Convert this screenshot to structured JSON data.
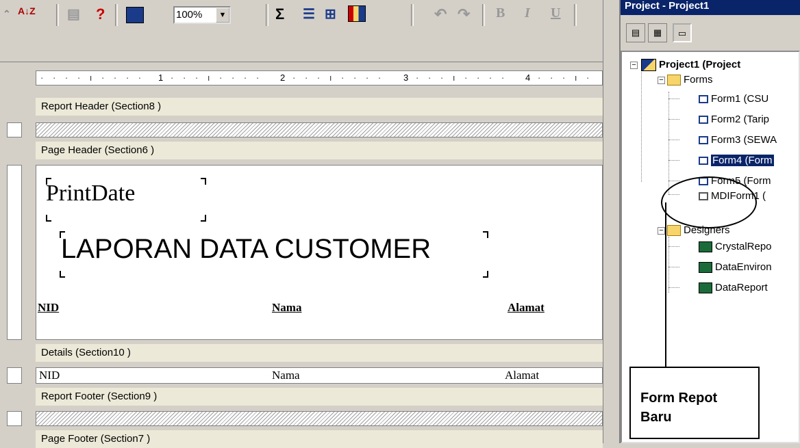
{
  "toolbar": {
    "zoom_value": "100%",
    "icons": [
      "sort-icon",
      "rows-icon",
      "help-icon",
      "save-as-icon",
      "sum-icon",
      "group-icon",
      "cross-tab-icon",
      "chart-icon",
      "undo-icon",
      "redo-icon",
      "bold-icon",
      "italic-icon",
      "underline-icon"
    ],
    "sort_glyph": "A↓Z",
    "help_glyph": "?",
    "sum_glyph": "Σ",
    "bold_glyph": "B",
    "italic_glyph": "I",
    "underline_glyph": "U",
    "undo_glyph": "↶",
    "redo_glyph": "↷"
  },
  "ruler": {
    "marks": [
      "1",
      "2",
      "3",
      "4"
    ]
  },
  "sections": {
    "report_header": "Report Header  (Section8 )",
    "page_header": "Page Header  (Section6 )",
    "details": "Details  (Section10 )",
    "report_footer": "Report Footer  (Section9 )",
    "page_footer": "Page Footer  (Section7 )"
  },
  "page_header_fields": {
    "print_date": "PrintDate",
    "title": "LAPORAN DATA CUSTOMER",
    "col_nid": "NID",
    "col_nama": "Nama",
    "col_alamat": "Alamat"
  },
  "details_fields": {
    "nid": "NID",
    "nama": "Nama",
    "alamat": "Alamat"
  },
  "project": {
    "title": "Project - Project1",
    "root": "Project1 (Project",
    "forms_folder": "Forms",
    "forms": [
      "Form1 (CSU",
      "Form2 (Tarip",
      "Form3 (SEWA",
      "Form4 (Form",
      "Form5 (Form",
      "MDIForm1 ("
    ],
    "designers_folder": "Designers",
    "designers": [
      "CrystalRepo",
      "DataEnviron",
      "DataReport"
    ],
    "selected_form_index": 3
  },
  "annotation": {
    "line1": "Form Repot",
    "line2": "Baru"
  },
  "colors": {
    "accent_title": "#0a246a",
    "section_bar": "#ece9d8"
  }
}
